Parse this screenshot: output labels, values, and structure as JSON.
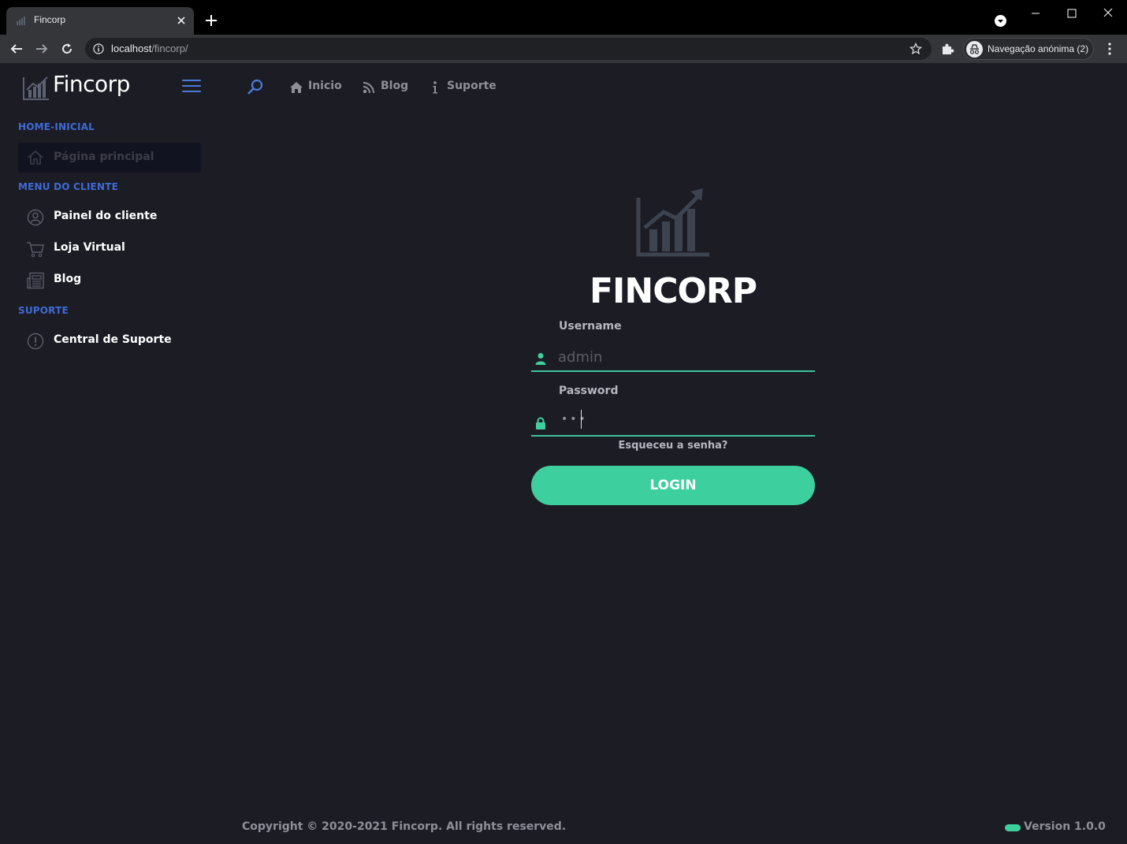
{
  "browser": {
    "tab_title": "Fincorp",
    "url_host": "localhost",
    "url_path": "/fincorp/",
    "profile_label": "Navegação anónima (2)"
  },
  "sidebar": {
    "brand": "Fincorp",
    "sections": [
      {
        "title": "HOME-INICIAL"
      },
      {
        "title": "MENU DO CLIENTE"
      },
      {
        "title": "SUPORTE"
      }
    ],
    "active_item": {
      "label": "Página principal",
      "icon": "home-icon"
    },
    "items": [
      {
        "label": "Painel do cliente",
        "icon": "user-circle-icon"
      },
      {
        "label": "Loja Virtual",
        "icon": "cart-icon"
      },
      {
        "label": "Blog",
        "icon": "newspaper-icon"
      },
      {
        "label": "Central de Suporte",
        "icon": "info-circle-icon"
      }
    ]
  },
  "topnav": {
    "items": [
      {
        "label": "Inicio",
        "icon": "home-icon"
      },
      {
        "label": "Blog",
        "icon": "feed-icon"
      },
      {
        "label": "Suporte",
        "icon": "info-icon"
      }
    ]
  },
  "login": {
    "title": "FINCORP",
    "username_label": "Username",
    "username_placeholder": "admin",
    "password_label": "Password",
    "password_dots": "•••",
    "forgot": "Esqueceu a senha?",
    "button": "LOGIN"
  },
  "footer": {
    "copyright": "Copyright © 2020-2021 Fincorp. All rights reserved.",
    "version": "Version 1.0.0"
  },
  "colors": {
    "background": "#1c1c25",
    "accent_green": "#3ecf9e",
    "accent_blue": "#3e6ad6"
  }
}
